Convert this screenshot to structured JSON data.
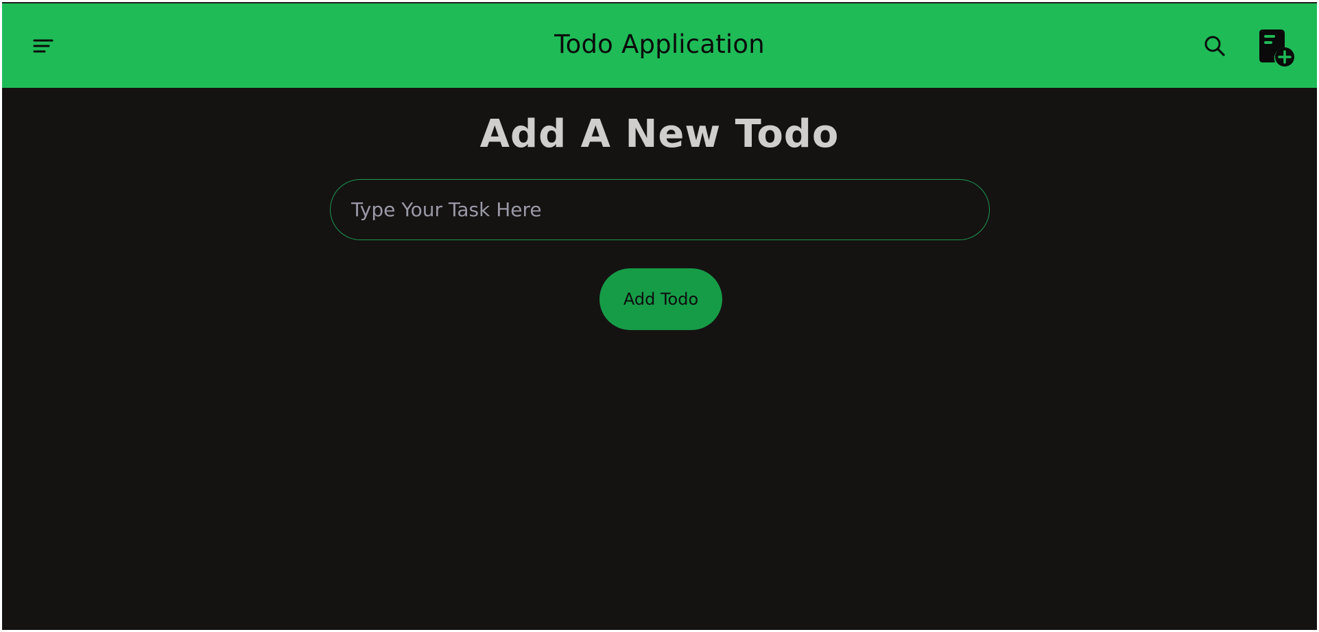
{
  "navbar": {
    "title": "Todo Application",
    "menu_icon": "menu-lines-icon",
    "search_icon": "search-icon",
    "add_icon": "note-add-icon",
    "background_color": "#1fbb57"
  },
  "main": {
    "heading": "Add A New Todo",
    "task_input": {
      "value": "",
      "placeholder": "Type Your Task Here"
    },
    "add_button_label": "Add Todo",
    "background_color": "#151212",
    "accent_color": "#169c47"
  }
}
